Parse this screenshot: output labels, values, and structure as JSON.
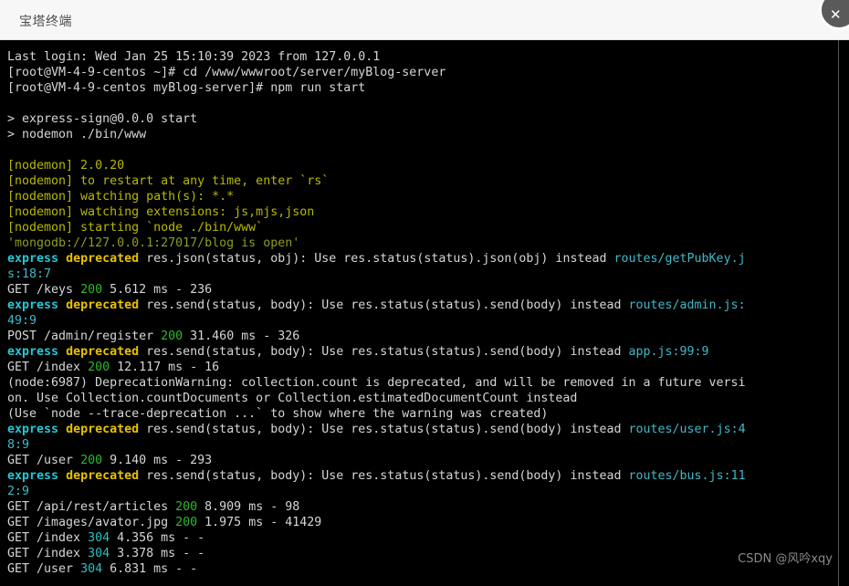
{
  "window": {
    "title": "宝塔终端",
    "close_icon": "close-icon",
    "close_glyph": "✕"
  },
  "watermark": {
    "text": "CSDN @风吟xqy"
  },
  "terminal": {
    "prompt_user": "root",
    "host": "VM-4-9-centos",
    "lines": [
      {
        "id": "l01",
        "segments": [
          {
            "text": "Last login: Wed Jan 25 15:10:39 2023 from 127.0.0.1",
            "cls": "c-white"
          }
        ]
      },
      {
        "id": "l02",
        "segments": [
          {
            "text": "[root@VM-4-9-centos ~]# cd /www/wwwroot/server/myBlog-server",
            "cls": "c-white"
          }
        ]
      },
      {
        "id": "l03",
        "segments": [
          {
            "text": "[root@VM-4-9-centos myBlog-server]# npm run start",
            "cls": "c-white"
          }
        ]
      },
      {
        "id": "l04",
        "segments": []
      },
      {
        "id": "l05",
        "segments": [
          {
            "text": "> express-sign@0.0.0 start",
            "cls": "c-white"
          }
        ]
      },
      {
        "id": "l06",
        "segments": [
          {
            "text": "> nodemon ./bin/www",
            "cls": "c-white"
          }
        ]
      },
      {
        "id": "l07",
        "segments": []
      },
      {
        "id": "l08",
        "segments": [
          {
            "text": "[nodemon] 2.0.20",
            "cls": "c-yellow"
          }
        ]
      },
      {
        "id": "l09",
        "segments": [
          {
            "text": "[nodemon] to restart at any time, enter `rs`",
            "cls": "c-yellow"
          }
        ]
      },
      {
        "id": "l10",
        "segments": [
          {
            "text": "[nodemon] watching path(s): *.*",
            "cls": "c-yellow"
          }
        ]
      },
      {
        "id": "l11",
        "segments": [
          {
            "text": "[nodemon] watching extensions: js,mjs,json",
            "cls": "c-yellow"
          }
        ]
      },
      {
        "id": "l12",
        "segments": [
          {
            "text": "[nodemon] starting `node ./bin/www`",
            "cls": "c-yellow"
          }
        ]
      },
      {
        "id": "l13",
        "segments": [
          {
            "text": "'mongodb://127.0.0.1:27017/blog is open'",
            "cls": "c-olive"
          }
        ]
      },
      {
        "id": "l14",
        "segments": [
          {
            "text": "express",
            "cls": "c-cyanb"
          },
          {
            "text": " ",
            "cls": "c-white"
          },
          {
            "text": "deprecated",
            "cls": "c-gold"
          },
          {
            "text": " res.json(status, obj): Use res.status(status).json(obj) instead ",
            "cls": "c-white"
          },
          {
            "text": "routes/getPubKey.j",
            "cls": "c-lightblue"
          }
        ]
      },
      {
        "id": "l15",
        "segments": [
          {
            "text": "s:18:7",
            "cls": "c-lightblue"
          }
        ]
      },
      {
        "id": "l16",
        "segments": [
          {
            "text": "GET /keys ",
            "cls": "c-white"
          },
          {
            "text": "200",
            "cls": "c-green"
          },
          {
            "text": " 5.612 ms - 236",
            "cls": "c-white"
          }
        ]
      },
      {
        "id": "l17",
        "segments": [
          {
            "text": "express",
            "cls": "c-cyanb"
          },
          {
            "text": " ",
            "cls": "c-white"
          },
          {
            "text": "deprecated",
            "cls": "c-gold"
          },
          {
            "text": " res.send(status, body): Use res.status(status).send(body) instead ",
            "cls": "c-white"
          },
          {
            "text": "routes/admin.js:",
            "cls": "c-lightblue"
          }
        ]
      },
      {
        "id": "l18",
        "segments": [
          {
            "text": "49:9",
            "cls": "c-lightblue"
          }
        ]
      },
      {
        "id": "l19",
        "segments": [
          {
            "text": "POST /admin/register ",
            "cls": "c-white"
          },
          {
            "text": "200",
            "cls": "c-green"
          },
          {
            "text": " 31.460 ms - 326",
            "cls": "c-white"
          }
        ]
      },
      {
        "id": "l20",
        "segments": [
          {
            "text": "express",
            "cls": "c-cyanb"
          },
          {
            "text": " ",
            "cls": "c-white"
          },
          {
            "text": "deprecated",
            "cls": "c-gold"
          },
          {
            "text": " res.send(status, body): Use res.status(status).send(body) instead ",
            "cls": "c-white"
          },
          {
            "text": "app.js:99:9",
            "cls": "c-lightblue"
          }
        ]
      },
      {
        "id": "l21",
        "segments": [
          {
            "text": "GET /index ",
            "cls": "c-white"
          },
          {
            "text": "200",
            "cls": "c-green"
          },
          {
            "text": " 12.117 ms - 16",
            "cls": "c-white"
          }
        ]
      },
      {
        "id": "l22",
        "segments": [
          {
            "text": "(node:6987) DeprecationWarning: collection.count is deprecated, and will be removed in a future versi",
            "cls": "c-white"
          }
        ]
      },
      {
        "id": "l23",
        "segments": [
          {
            "text": "on. Use Collection.countDocuments or Collection.estimatedDocumentCount instead",
            "cls": "c-white"
          }
        ]
      },
      {
        "id": "l24",
        "segments": [
          {
            "text": "(Use `node --trace-deprecation ...` to show where the warning was created)",
            "cls": "c-white"
          }
        ]
      },
      {
        "id": "l25",
        "segments": [
          {
            "text": "express",
            "cls": "c-cyanb"
          },
          {
            "text": " ",
            "cls": "c-white"
          },
          {
            "text": "deprecated",
            "cls": "c-gold"
          },
          {
            "text": " res.send(status, body): Use res.status(status).send(body) instead ",
            "cls": "c-white"
          },
          {
            "text": "routes/user.js:4",
            "cls": "c-lightblue"
          }
        ]
      },
      {
        "id": "l26",
        "segments": [
          {
            "text": "8:9",
            "cls": "c-lightblue"
          }
        ]
      },
      {
        "id": "l27",
        "segments": [
          {
            "text": "GET /user ",
            "cls": "c-white"
          },
          {
            "text": "200",
            "cls": "c-green"
          },
          {
            "text": " 9.140 ms - 293",
            "cls": "c-white"
          }
        ]
      },
      {
        "id": "l28",
        "segments": [
          {
            "text": "express",
            "cls": "c-cyanb"
          },
          {
            "text": " ",
            "cls": "c-white"
          },
          {
            "text": "deprecated",
            "cls": "c-gold"
          },
          {
            "text": " res.send(status, body): Use res.status(status).send(body) instead ",
            "cls": "c-white"
          },
          {
            "text": "routes/bus.js:11",
            "cls": "c-lightblue"
          }
        ]
      },
      {
        "id": "l29",
        "segments": [
          {
            "text": "2:9",
            "cls": "c-lightblue"
          }
        ]
      },
      {
        "id": "l30",
        "segments": [
          {
            "text": "GET /api/rest/articles ",
            "cls": "c-white"
          },
          {
            "text": "200",
            "cls": "c-green"
          },
          {
            "text": " 8.909 ms - 98",
            "cls": "c-white"
          }
        ]
      },
      {
        "id": "l31",
        "segments": [
          {
            "text": "GET /images/avator.jpg ",
            "cls": "c-white"
          },
          {
            "text": "200",
            "cls": "c-green"
          },
          {
            "text": " 1.975 ms - 41429",
            "cls": "c-white"
          }
        ]
      },
      {
        "id": "l32",
        "segments": [
          {
            "text": "GET /index ",
            "cls": "c-white"
          },
          {
            "text": "304",
            "cls": "c-cyan"
          },
          {
            "text": " 4.356 ms - -",
            "cls": "c-white"
          }
        ]
      },
      {
        "id": "l33",
        "segments": [
          {
            "text": "GET /index ",
            "cls": "c-white"
          },
          {
            "text": "304",
            "cls": "c-cyan"
          },
          {
            "text": " 3.378 ms - -",
            "cls": "c-white"
          }
        ]
      },
      {
        "id": "l34",
        "segments": [
          {
            "text": "GET /user ",
            "cls": "c-white"
          },
          {
            "text": "304",
            "cls": "c-cyan"
          },
          {
            "text": " 6.831 ms - -",
            "cls": "c-white"
          }
        ]
      }
    ]
  },
  "colors": {
    "background": "#000000",
    "titlebar_bg": "#f7f7f7",
    "text_default": "#d6d6d6",
    "status_200": "#2eb82e",
    "status_304": "#2fbfbf",
    "express_label": "#24c7d6",
    "deprecated_label": "#e8c100",
    "file_path": "#3fb9c9",
    "nodemon": "#b8b800",
    "mongodb": "#8f9c1f"
  }
}
